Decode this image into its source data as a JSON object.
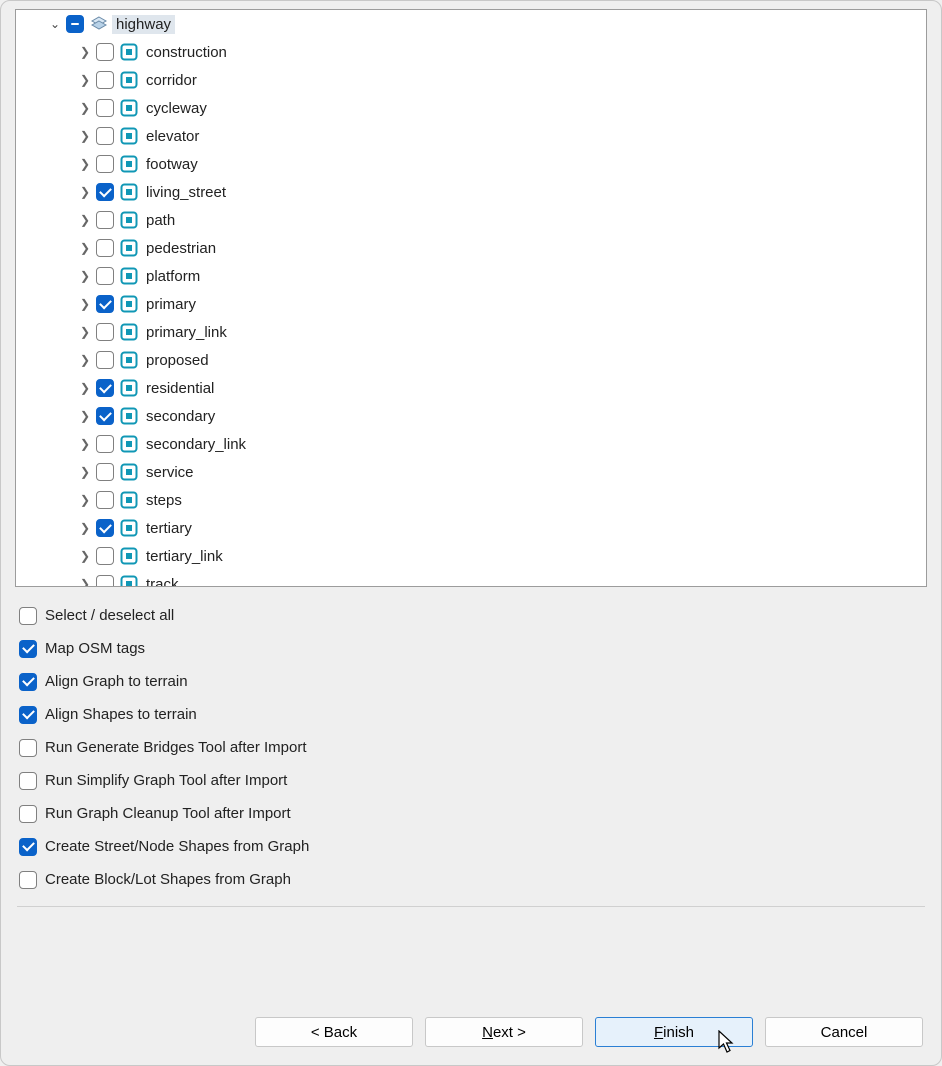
{
  "tree": {
    "root": {
      "label": "highway",
      "state": "mixed",
      "selected": true
    },
    "children": [
      {
        "label": "construction",
        "checked": false
      },
      {
        "label": "corridor",
        "checked": false
      },
      {
        "label": "cycleway",
        "checked": false
      },
      {
        "label": "elevator",
        "checked": false
      },
      {
        "label": "footway",
        "checked": false
      },
      {
        "label": "living_street",
        "checked": true
      },
      {
        "label": "path",
        "checked": false
      },
      {
        "label": "pedestrian",
        "checked": false
      },
      {
        "label": "platform",
        "checked": false
      },
      {
        "label": "primary",
        "checked": true
      },
      {
        "label": "primary_link",
        "checked": false
      },
      {
        "label": "proposed",
        "checked": false
      },
      {
        "label": "residential",
        "checked": true
      },
      {
        "label": "secondary",
        "checked": true
      },
      {
        "label": "secondary_link",
        "checked": false
      },
      {
        "label": "service",
        "checked": false
      },
      {
        "label": "steps",
        "checked": false
      },
      {
        "label": "tertiary",
        "checked": true
      },
      {
        "label": "tertiary_link",
        "checked": false
      },
      {
        "label": "track",
        "checked": false
      }
    ]
  },
  "options": [
    {
      "label": "Select / deselect all",
      "checked": false
    },
    {
      "label": "Map OSM tags",
      "checked": true
    },
    {
      "label": "Align Graph to terrain",
      "checked": true
    },
    {
      "label": "Align Shapes to terrain",
      "checked": true
    },
    {
      "label": "Run Generate Bridges Tool after Import",
      "checked": false
    },
    {
      "label": "Run Simplify Graph Tool after Import",
      "checked": false
    },
    {
      "label": "Run Graph Cleanup Tool after Import",
      "checked": false
    },
    {
      "label": "Create Street/Node Shapes from Graph",
      "checked": true
    },
    {
      "label": "Create Block/Lot Shapes from Graph",
      "checked": false
    }
  ],
  "buttons": {
    "back": "< Back",
    "next_prefix": "N",
    "next_rest": "ext >",
    "finish_prefix": "F",
    "finish_rest": "inish",
    "cancel": "Cancel"
  }
}
